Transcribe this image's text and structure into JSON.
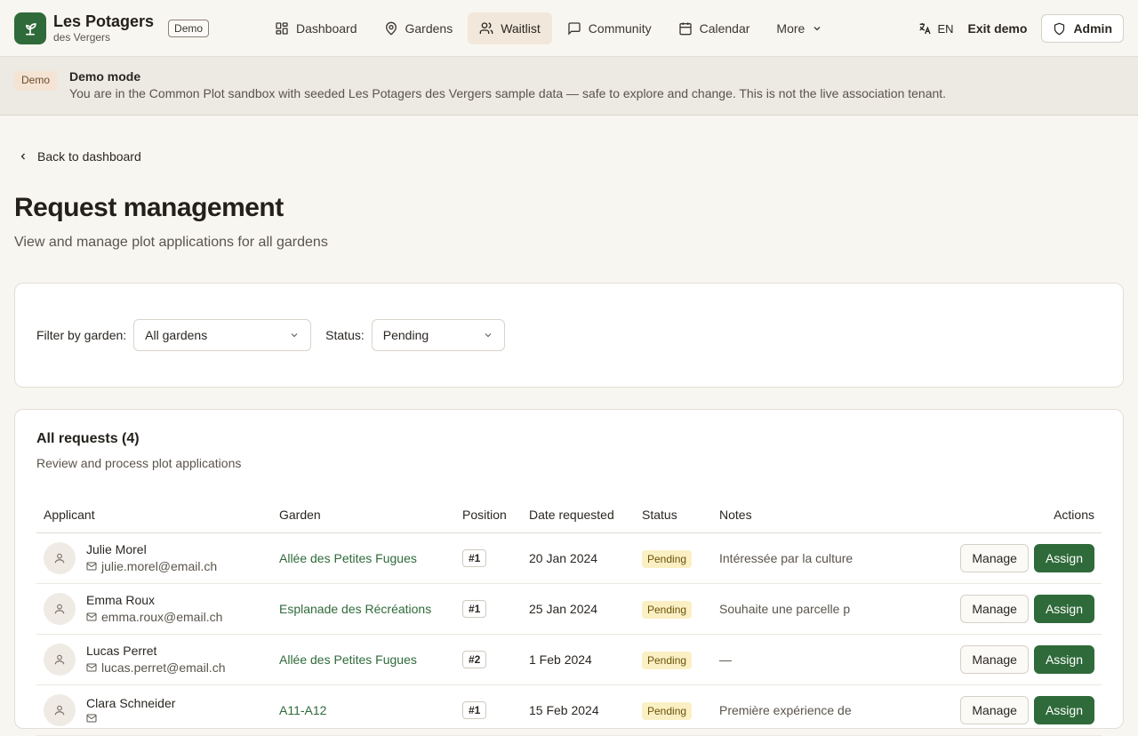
{
  "header": {
    "brand_name": "Les Potagers",
    "brand_sub": "des Vergers",
    "demo_badge": "Demo",
    "nav": [
      {
        "label": "Dashboard",
        "icon": "dashboard-icon"
      },
      {
        "label": "Gardens",
        "icon": "map-pin-icon"
      },
      {
        "label": "Waitlist",
        "icon": "users-icon",
        "active": true
      },
      {
        "label": "Community",
        "icon": "message-icon"
      },
      {
        "label": "Calendar",
        "icon": "calendar-icon"
      },
      {
        "label": "More",
        "icon": "chevron-down-icon"
      }
    ],
    "lang": "EN",
    "exit_demo": "Exit demo",
    "admin": "Admin"
  },
  "banner": {
    "tag": "Demo",
    "title": "Demo mode",
    "text": "You are in the Common Plot sandbox with seeded Les Potagers des Vergers sample data — safe to explore and change. This is not the live association tenant."
  },
  "page": {
    "back": "Back to dashboard",
    "title": "Request management",
    "subtitle": "View and manage plot applications for all gardens"
  },
  "filters": {
    "garden_label": "Filter by garden:",
    "garden_value": "All gardens",
    "status_label": "Status:",
    "status_value": "Pending"
  },
  "requests": {
    "title": "All requests (4)",
    "description": "Review and process plot applications",
    "columns": [
      "Applicant",
      "Garden",
      "Position",
      "Date requested",
      "Status",
      "Notes",
      "Actions"
    ],
    "manage_label": "Manage",
    "assign_label": "Assign",
    "rows": [
      {
        "name": "Julie Morel",
        "email": "julie.morel@email.ch",
        "garden": "Allée des Petites Fugues",
        "position": "#1",
        "date": "20 Jan 2024",
        "status": "Pending",
        "notes": "Intéressée par la culture"
      },
      {
        "name": "Emma Roux",
        "email": "emma.roux@email.ch",
        "garden": "Esplanade des Récréations",
        "position": "#1",
        "date": "25 Jan 2024",
        "status": "Pending",
        "notes": "Souhaite une parcelle p"
      },
      {
        "name": "Lucas Perret",
        "email": "lucas.perret@email.ch",
        "garden": "Allée des Petites Fugues",
        "position": "#2",
        "date": "1 Feb 2024",
        "status": "Pending",
        "notes": "—"
      },
      {
        "name": "Clara Schneider",
        "email": "",
        "garden": "A11-A12",
        "position": "#1",
        "date": "15 Feb 2024",
        "status": "Pending",
        "notes": "Première expérience de"
      }
    ]
  }
}
